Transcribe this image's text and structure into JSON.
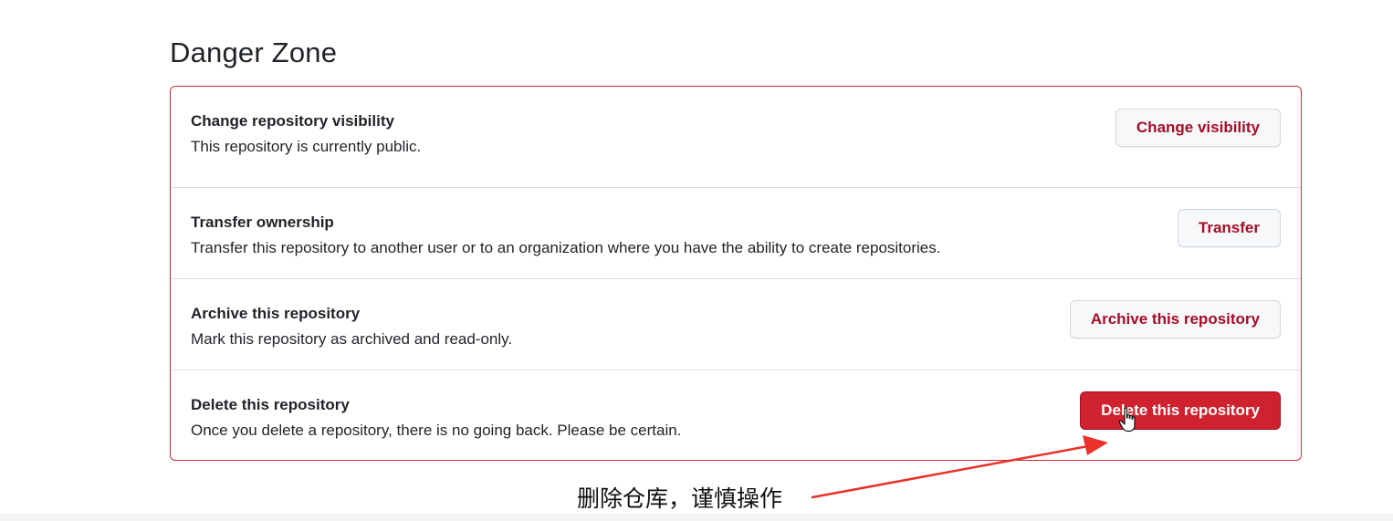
{
  "danger_zone": {
    "title": "Danger Zone",
    "rows": [
      {
        "title": "Change repository visibility",
        "description": "This repository is currently public.",
        "button": "Change visibility"
      },
      {
        "title": "Transfer ownership",
        "description": "Transfer this repository to another user or to an organization where you have the ability to create repositories.",
        "button": "Transfer"
      },
      {
        "title": "Archive this repository",
        "description": "Mark this repository as archived and read-only.",
        "button": "Archive this repository"
      },
      {
        "title": "Delete this repository",
        "description": "Once you delete a repository, there is no going back. Please be certain.",
        "button": "Delete this repository"
      }
    ]
  },
  "annotation": {
    "text": "删除仓库，谨慎操作",
    "arrow_color": "#e8322a"
  },
  "colors": {
    "danger_border": "#c22f3a",
    "danger_button": "#cf222e",
    "danger_text": "#a40e26"
  },
  "icons": {
    "cursor": "hand-pointer-icon",
    "arrow": "arrow-icon"
  }
}
